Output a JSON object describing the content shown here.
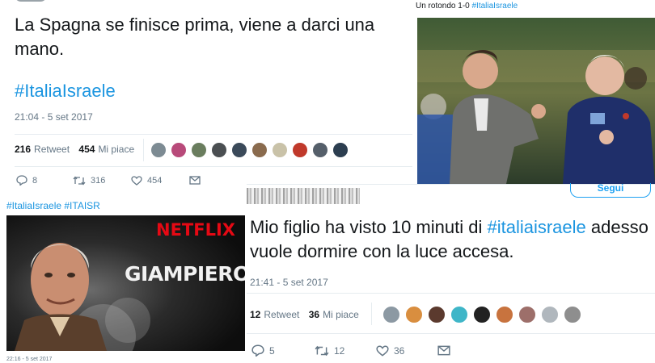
{
  "tweet1": {
    "text": "La Spagna se finisce prima, viene a darci una mano.",
    "hashtag": "#ItaliaIsraele",
    "timestamp": "21:04 - 5 set 2017",
    "retweet_count": "216",
    "retweet_label": "Retweet",
    "like_count": "454",
    "like_label": "Mi piace",
    "reply_count": "8",
    "action_retweet_count": "316",
    "action_like_count": "454",
    "liker_colors": [
      "#7d8b93",
      "#b84a7a",
      "#6a7d5e",
      "#4b4f52",
      "#3b4a5a",
      "#8a6b4e",
      "#c9c2a8",
      "#c0392b",
      "#555f6a",
      "#2c3e50"
    ]
  },
  "photo_tweet": {
    "caption_prefix": "Un rotondo 1-0",
    "caption_hashtag": "#ItaliaIsraele"
  },
  "meme": {
    "caption": "#ItaliaIsraele #ITAISR",
    "brand": "NETFLIX",
    "title": "GIAMPIEROS",
    "timestamp": "22:16 - 5 set 2017"
  },
  "tweet2": {
    "follow_label": "Segui",
    "text_prefix": "Mio figlio ha visto 10 minuti di ",
    "hashtag": "#italiaisraele",
    "text_suffix": " adesso vuole dormire con la luce accesa.",
    "timestamp": "21:41 - 5 set 2017",
    "retweet_count": "12",
    "retweet_label": "Retweet",
    "like_count": "36",
    "like_label": "Mi piace",
    "reply_count": "5",
    "action_retweet_count": "12",
    "action_like_count": "36",
    "liker_colors": [
      "#8c99a3",
      "#d98e3f",
      "#5b3a2e",
      "#3fb6c8",
      "#222222",
      "#c8733e",
      "#9d6f6a",
      "#b0b7bd",
      "#8e8e8e"
    ]
  },
  "colors": {
    "link": "#1b95e0",
    "netflix_red": "#e50914",
    "text": "#14171a",
    "muted": "#657786"
  }
}
